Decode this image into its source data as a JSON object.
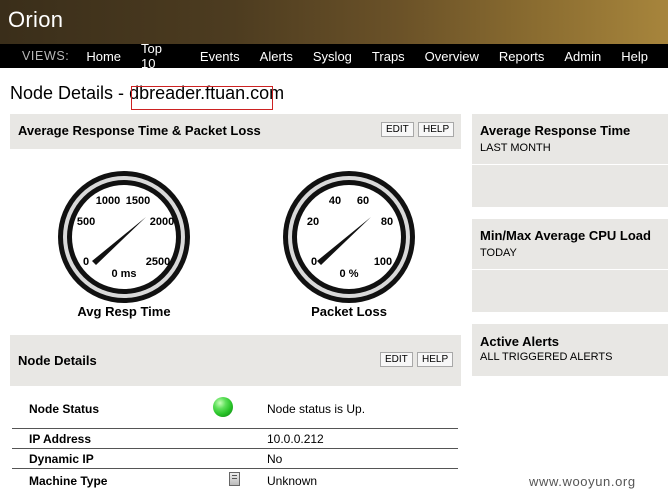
{
  "app": {
    "title": "Orion"
  },
  "nav": {
    "views_label": "VIEWS:",
    "items": [
      "Home",
      "Top 10",
      "Events",
      "Alerts",
      "Syslog",
      "Traps",
      "Overview",
      "Reports",
      "Admin",
      "Help"
    ]
  },
  "page": {
    "title": "Node Details - ",
    "node_name": "dbreader.ftuan.com"
  },
  "response_panel": {
    "title": "Average Response Time & Packet Loss",
    "edit": "EDIT",
    "help": "HELP",
    "gauges": [
      {
        "label": "Avg Resp Time",
        "unit_text": "0 ms",
        "value": 0,
        "max": 2500,
        "ticks": [
          "0",
          "500",
          "1000",
          "1500",
          "2000",
          "2500"
        ]
      },
      {
        "label": "Packet Loss",
        "unit_text": "0 %",
        "value": 0,
        "max": 100,
        "ticks": [
          "0",
          "20",
          "40",
          "60",
          "80",
          "100"
        ]
      }
    ]
  },
  "node_panel": {
    "title": "Node Details",
    "edit": "EDIT",
    "help": "HELP",
    "rows": [
      {
        "label": "Node Status",
        "value": "Node status is Up.",
        "icon": "status-up-icon"
      },
      {
        "label": "IP Address",
        "value": "10.0.0.212"
      },
      {
        "label": "Dynamic IP",
        "value": "No"
      },
      {
        "label": "Machine Type",
        "value": "Unknown",
        "icon": "machine-icon"
      }
    ]
  },
  "sidebar": [
    {
      "title": "Average Response Time",
      "subtitle": "LAST MONTH"
    },
    {
      "title": "Min/Max Average CPU Load",
      "subtitle": "TODAY"
    },
    {
      "title": "Active Alerts",
      "subtitle": "ALL TRIGGERED ALERTS"
    }
  ],
  "watermark": "www.wooyun.org",
  "colors": {
    "status_up": "#27c227",
    "nav_bg": "#000000",
    "panel_bg": "#e8e7e4",
    "highlight_box": "#cc2222"
  }
}
